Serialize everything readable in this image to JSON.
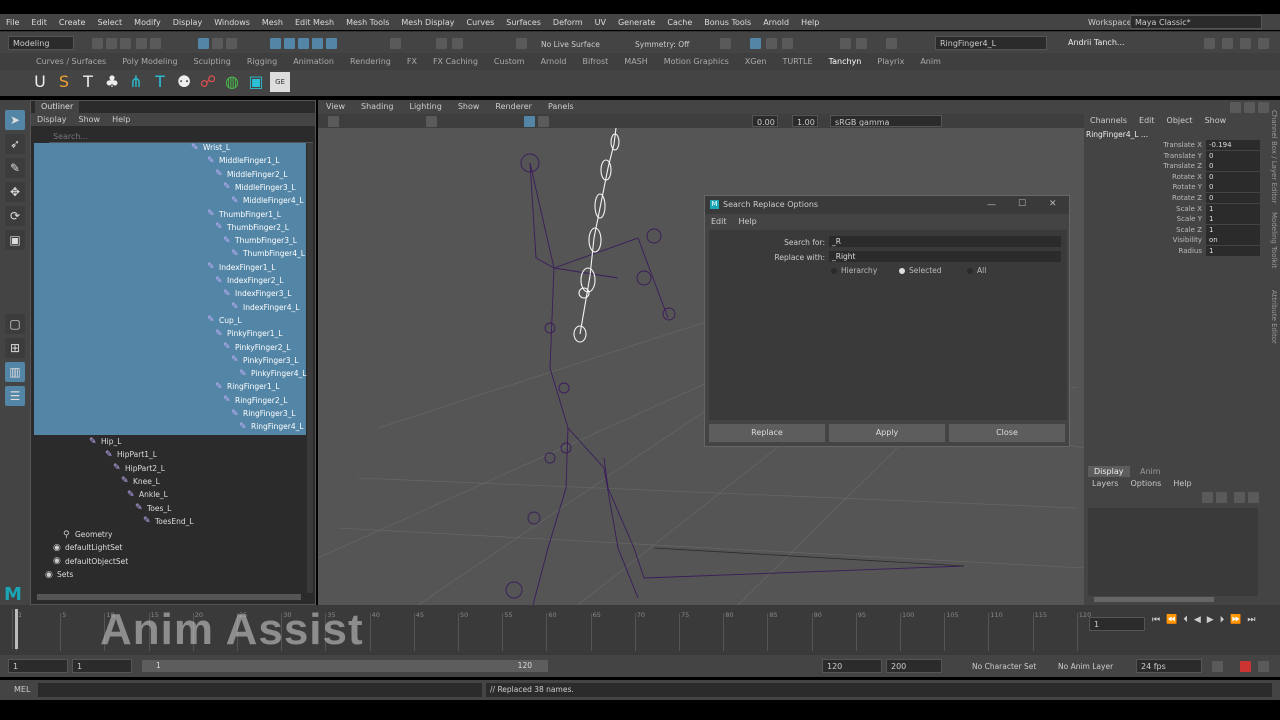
{
  "menubar": {
    "items": [
      "File",
      "Edit",
      "Create",
      "Select",
      "Modify",
      "Display",
      "Windows",
      "Mesh",
      "Edit Mesh",
      "Mesh Tools",
      "Mesh Display",
      "Curves",
      "Surfaces",
      "Deform",
      "UV",
      "Generate",
      "Cache",
      "Bonus Tools",
      "Arnold",
      "Help"
    ],
    "workspace_label": "Workspace :",
    "workspace_value": "Maya Classic*"
  },
  "statusline": {
    "mode": "Modeling",
    "live_surface": "No Live Surface",
    "symmetry": "Symmetry: Off",
    "object_name": "RingFinger4_L",
    "user": "Andrii Tanch..."
  },
  "shelf": {
    "tabs": [
      "Curves / Surfaces",
      "Poly Modeling",
      "Sculpting",
      "Rigging",
      "Animation",
      "Rendering",
      "FX",
      "FX Caching",
      "Custom",
      "Arnold",
      "Bifrost",
      "MASH",
      "Motion Graphics",
      "XGen",
      "TURTLE",
      "Tanchyn",
      "Playrix",
      "Anim"
    ],
    "active_tab": "Tanchyn",
    "icons": [
      "U",
      "S",
      "T",
      "♣",
      "⋔",
      "T",
      "⚉",
      "☍",
      "◍",
      "▣",
      "GE"
    ]
  },
  "outliner": {
    "tab": "Outliner",
    "menu": [
      "Display",
      "Show",
      "Help"
    ],
    "search_placeholder": "Search...",
    "selected_items": [
      "Wrist_L",
      "MiddleFinger1_L",
      "MiddleFinger2_L",
      "MiddleFinger3_L",
      "MiddleFinger4_L",
      "ThumbFinger1_L",
      "ThumbFinger2_L",
      "ThumbFinger3_L",
      "ThumbFinger4_L",
      "IndexFinger1_L",
      "IndexFinger2_L",
      "IndexFinger3_L",
      "IndexFinger4_L",
      "Cup_L",
      "PinkyFinger1_L",
      "PinkyFinger2_L",
      "PinkyFinger3_L",
      "PinkyFinger4_L",
      "RingFinger1_L",
      "RingFinger2_L",
      "RingFinger3_L",
      "RingFinger4_L"
    ],
    "other_items": [
      "Hip_L",
      "HipPart1_L",
      "HipPart2_L",
      "Knee_L",
      "Ankle_L",
      "Toes_L",
      "ToesEnd_L",
      "Geometry",
      "defaultLightSet",
      "defaultObjectSet",
      "Sets"
    ]
  },
  "viewport": {
    "menu": [
      "View",
      "Shading",
      "Lighting",
      "Show",
      "Renderer",
      "Panels"
    ],
    "field_a": "0.00",
    "field_b": "1.00",
    "color_space": "sRGB gamma"
  },
  "dialog": {
    "title": "Search Replace Options",
    "menu": [
      "Edit",
      "Help"
    ],
    "search_label": "Search for:",
    "search_value": "_R",
    "replace_label": "Replace with:",
    "replace_value": "_Right",
    "radio_hierarchy": "Hierarchy",
    "radio_selected": "Selected",
    "radio_all": "All",
    "selected_option": "Selected",
    "btn_replace": "Replace",
    "btn_apply": "Apply",
    "btn_close": "Close"
  },
  "channelbox": {
    "menu": [
      "Channels",
      "Edit",
      "Object",
      "Show"
    ],
    "object": "RingFinger4_L ...",
    "attributes": [
      {
        "name": "Translate X",
        "value": "-0.194"
      },
      {
        "name": "Translate Y",
        "value": "0"
      },
      {
        "name": "Translate Z",
        "value": "0"
      },
      {
        "name": "Rotate X",
        "value": "0"
      },
      {
        "name": "Rotate Y",
        "value": "0"
      },
      {
        "name": "Rotate Z",
        "value": "0"
      },
      {
        "name": "Scale X",
        "value": "1"
      },
      {
        "name": "Scale Y",
        "value": "1"
      },
      {
        "name": "Scale Z",
        "value": "1"
      },
      {
        "name": "Visibility",
        "value": "on"
      },
      {
        "name": "Radius",
        "value": "1"
      }
    ],
    "side_tabs": [
      "Channel Box / Layer Editor",
      "Modeling Toolkit",
      "Attribute Editor"
    ],
    "layer_tabs": [
      "Display",
      "Anim"
    ],
    "layer_menu": [
      "Layers",
      "Options",
      "Help"
    ]
  },
  "timeline": {
    "ticks": [
      "1",
      "5",
      "10",
      "15",
      "20",
      "25",
      "30",
      "35",
      "40",
      "45",
      "50",
      "55",
      "60",
      "65",
      "70",
      "75",
      "80",
      "85",
      "90",
      "95",
      "100",
      "105",
      "110",
      "115",
      "120"
    ],
    "current_frame": "1",
    "range_start": "1",
    "range_start2": "1",
    "range_inner_start": "1",
    "range_inner_end": "120",
    "range_end": "120",
    "range_end2": "200",
    "character_set": "No Character Set",
    "anim_layer": "No Anim Layer",
    "fps": "24 fps"
  },
  "cmdline": {
    "lang": "MEL",
    "result": "// Replaced 38 names."
  },
  "watermark": "Anim Assist"
}
